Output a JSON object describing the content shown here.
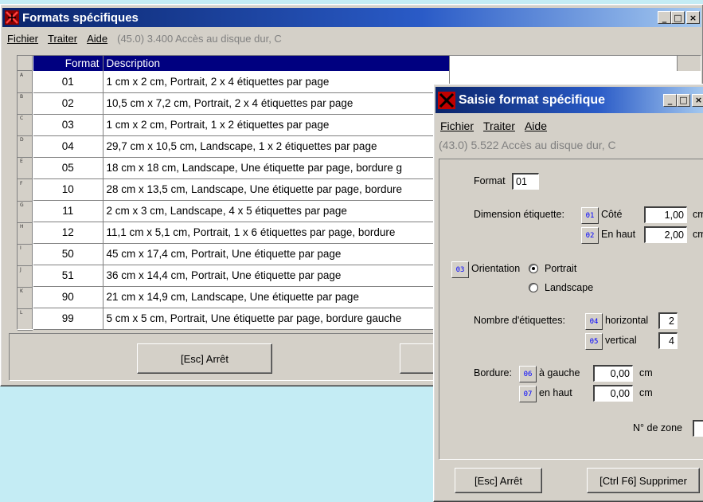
{
  "main_window": {
    "title": "Formats spécifiques",
    "menu": [
      {
        "label": "Fichier"
      },
      {
        "label": "Traiter"
      },
      {
        "label": "Aide"
      }
    ],
    "status": "(45.0) 3.400 Accès au disque dur, C",
    "grid": {
      "headers": {
        "format": "Format",
        "description": "Description"
      },
      "row_letters": [
        "A",
        "B",
        "C",
        "D",
        "E",
        "F",
        "G",
        "H",
        "I",
        "J",
        "K",
        "L"
      ],
      "rows": [
        {
          "format": "01",
          "description": "1 cm x 2 cm, Portrait, 2 x 4 étiquettes par page"
        },
        {
          "format": "02",
          "description": "10,5 cm x 7,2 cm, Portrait, 2 x 4 étiquettes par page"
        },
        {
          "format": "03",
          "description": "1 cm x 2 cm, Portrait, 1 x 2 étiquettes par page"
        },
        {
          "format": "04",
          "description": "29,7 cm x 10,5 cm, Landscape, 1 x 2 étiquettes par page"
        },
        {
          "format": "05",
          "description": "18 cm x 18 cm, Landscape, Une étiquette par page, bordure g"
        },
        {
          "format": "10",
          "description": "28 cm x 13,5 cm, Landscape, Une étiquette par page, bordure"
        },
        {
          "format": "11",
          "description": "2 cm x 3 cm, Landscape, 4 x 5 étiquettes par page"
        },
        {
          "format": "12",
          "description": "11,1 cm x 5,1 cm, Portrait, 1 x 6 étiquettes par page, bordure"
        },
        {
          "format": "50",
          "description": "45 cm x 17,4 cm, Portrait, Une étiquette par page"
        },
        {
          "format": "51",
          "description": "36 cm x 14,4 cm, Portrait, Une étiquette par page"
        },
        {
          "format": "90",
          "description": "21 cm x 14,9 cm, Landscape, Une étiquette par page"
        },
        {
          "format": "99",
          "description": "5 cm x 5 cm, Portrait, Une étiquette par page, bordure gauche"
        }
      ]
    },
    "stop_button": "[Esc] Arrêt"
  },
  "dialog": {
    "title": "Saisie format spécifique",
    "menu": [
      {
        "label": "Fichier"
      },
      {
        "label": "Traiter"
      },
      {
        "label": "Aide"
      }
    ],
    "status": "(43.0) 5.522 Accès au disque dur, C",
    "format_label": "Format",
    "format_value": "01",
    "dimension_label": "Dimension étiquette:",
    "fkey_01": "01",
    "cote_label": "Côté",
    "cote_value": "1,00",
    "fkey_02": "02",
    "en_haut_label": "En haut",
    "en_haut_value": "2,00",
    "unit_cm": "cm",
    "fkey_03": "03",
    "orientation_label": "Orientation",
    "portrait_label": "Portrait",
    "landscape_label": "Landscape",
    "orientation_selected": "Portrait",
    "nombre_label": "Nombre d'étiquettes:",
    "fkey_04": "04",
    "horizontal_label": "horizontal",
    "horizontal_value": "2",
    "fkey_05": "05",
    "vertical_label": "vertical",
    "vertical_value": "4",
    "bordure_label": "Bordure:",
    "fkey_06": "06",
    "a_gauche_label": "à gauche",
    "a_gauche_value": "0,00",
    "fkey_07": "07",
    "en_haut2_label": "en haut",
    "en_haut2_value": "0,00",
    "zone_label": "N° de zone",
    "stop_button": "[Esc] Arrêt",
    "delete_button": "[Ctrl F6] Supprimer"
  },
  "colors": {
    "desktop": "#c4ecf4",
    "titlebar_active": "#0a246a",
    "grid_header": "#000080",
    "fkey_text": "#0000ff"
  }
}
